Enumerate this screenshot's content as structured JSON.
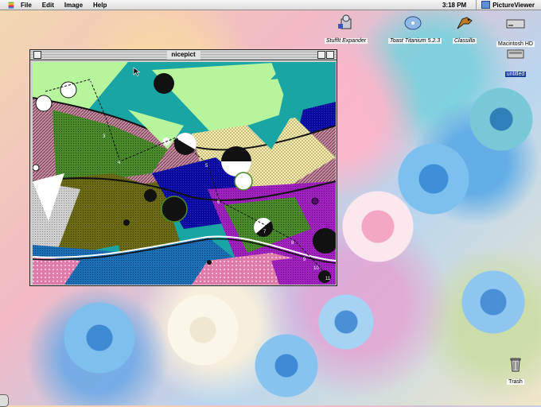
{
  "menubar": {
    "menus": [
      "File",
      "Edit",
      "Image",
      "Help"
    ],
    "clock": "3:18 PM",
    "app_name": "PictureViewer"
  },
  "desktop_icons": {
    "stuffit": "StuffIt Expander",
    "toast": "Toast Titanium 5.2.3",
    "classilla": "Classilla",
    "macintosh_hd": "Macintosh HD",
    "untitled": "untitled",
    "trash": "Trash"
  },
  "window": {
    "title": "nicepict"
  },
  "picture": {
    "labels": [
      "1",
      "2",
      "3",
      "4",
      "5",
      "6",
      "7",
      "8",
      "9",
      "10",
      "11"
    ]
  },
  "colors": {
    "menubar": "#dcdcdc",
    "window_chrome": "#cfcfcf",
    "teal": "#1aa5a5",
    "mint": "#b6f59c",
    "olive": "#6b6b12",
    "navy": "#0a0a9c",
    "purple": "#a020c0",
    "blue": "#1b6fb5",
    "pink": "#e07aa8",
    "checker": "#efe7a8"
  }
}
